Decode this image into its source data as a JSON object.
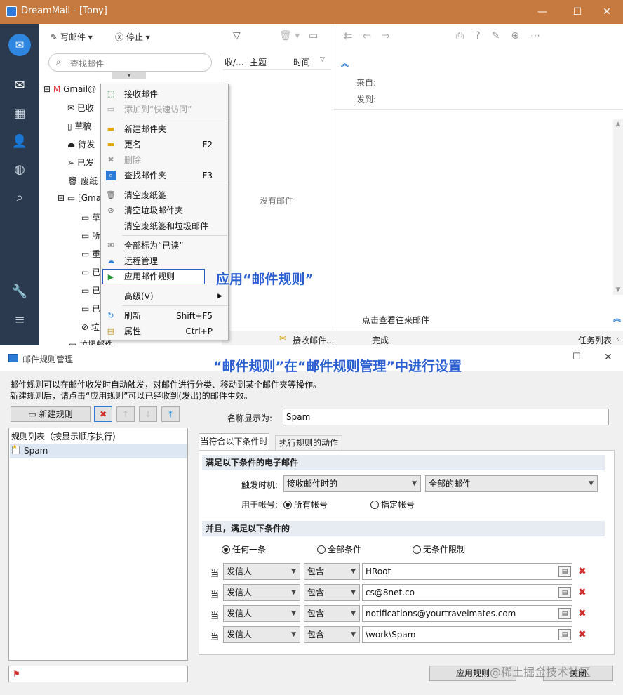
{
  "window": {
    "title": "DreamMail - [Tony]"
  },
  "toolbar": {
    "compose": "写邮件",
    "stop": "停止"
  },
  "search": {
    "placeholder": "查找邮件"
  },
  "tree": {
    "account": "Gmail@",
    "folders": [
      "已收",
      "草稿",
      "待发",
      "已发",
      "废纸"
    ],
    "gmail_group": "[Gma",
    "subfolders": [
      "草",
      "所",
      "重",
      "已",
      "已",
      "已",
      "垃"
    ],
    "spam": "垃圾邮件"
  },
  "list": {
    "col_from": "收/...",
    "col_subject": "主题",
    "col_time": "时间",
    "empty": "没有邮件"
  },
  "reader": {
    "from_label": "来自:",
    "to_label": "发到:",
    "view_exchange": "点击查看往来邮件"
  },
  "status": {
    "receiving": "接收邮件...",
    "done": "完成",
    "tasks": "任务列表"
  },
  "context_menu": {
    "items": [
      {
        "label": "接收邮件",
        "shortcut": "",
        "icon": "receive-mail-icon"
      },
      {
        "label": "添加到“快速访问”",
        "shortcut": "",
        "icon": "quick-access-icon"
      },
      {
        "label": "新建邮件夹",
        "shortcut": "",
        "icon": "new-folder-icon"
      },
      {
        "label": "更名",
        "shortcut": "F2",
        "icon": "rename-icon"
      },
      {
        "label": "删除",
        "shortcut": "",
        "icon": "delete-icon"
      },
      {
        "label": "查找邮件夹",
        "shortcut": "F3",
        "icon": "find-folder-icon"
      },
      {
        "label": "清空废纸篓",
        "shortcut": "",
        "icon": "trash-icon"
      },
      {
        "label": "清空垃圾邮件夹",
        "shortcut": "",
        "icon": "block-icon"
      },
      {
        "label": "清空废纸篓和垃圾邮件",
        "shortcut": "",
        "icon": ""
      },
      {
        "label": "全部标为“已读”",
        "shortcut": "",
        "icon": "mark-read-icon"
      },
      {
        "label": "远程管理",
        "shortcut": "",
        "icon": "cloud-icon"
      },
      {
        "label": "应用邮件规则",
        "shortcut": "",
        "icon": "apply-rule-icon"
      },
      {
        "label": "高级(V)",
        "shortcut": "",
        "icon": ""
      },
      {
        "label": "刷新",
        "shortcut": "Shift+F5",
        "icon": "refresh-icon"
      },
      {
        "label": "属性",
        "shortcut": "Ctrl+P",
        "icon": "properties-icon"
      }
    ]
  },
  "annotations": {
    "apply_rule": "应用“邮件规则”",
    "manage_rule": "“邮件规则”在“邮件规则管理”中进行设置"
  },
  "dialog": {
    "title": "邮件规则管理",
    "desc1": "邮件规则可以在邮件收发时自动触发，对邮件进行分类、移动到某个邮件夹等操作。",
    "desc2": "新建规则后，请点击“应用规则”可以已经收到(发出)的邮件生效。",
    "new_rule": "新建规则",
    "rule_list_header": "规则列表（按显示顺序执行)",
    "rules": [
      "Spam"
    ],
    "name_label": "名称显示为:",
    "name_value": "Spam",
    "tab_conditions": "当符合以下条件时",
    "tab_actions": "执行规则的动作",
    "section1": "满足以下条件的电子邮件",
    "trigger_label": "触发时机:",
    "trigger_value": "接收邮件时的",
    "scope_value": "全部的邮件",
    "account_label": "用于帐号:",
    "radio_all_accounts": "所有帐号",
    "radio_specific_account": "指定帐号",
    "section2": "并且，满足以下条件的",
    "radio_any": "任何一条",
    "radio_all": "全部条件",
    "radio_none": "无条件限制",
    "conditions": [
      {
        "prefix": "当",
        "field": "发信人",
        "op": "包含",
        "value": "HRoot"
      },
      {
        "prefix": "当",
        "field": "发信人",
        "op": "包含",
        "value": "cs@8net.co"
      },
      {
        "prefix": "当",
        "field": "发信人",
        "op": "包含",
        "value": "notifications@yourtravelmates.com"
      },
      {
        "prefix": "当",
        "field": "发信人",
        "op": "包含",
        "value": "\\work\\Spam"
      }
    ],
    "apply_button": "应用规则",
    "close_button": "关闭"
  },
  "watermark": "@稀土掘金技术社区",
  "colors": {
    "titlebar": "#c77a3f",
    "sidebar": "#2b3a4e",
    "annotation": "#2b5fd0",
    "delete_red": "#d12b2b"
  }
}
